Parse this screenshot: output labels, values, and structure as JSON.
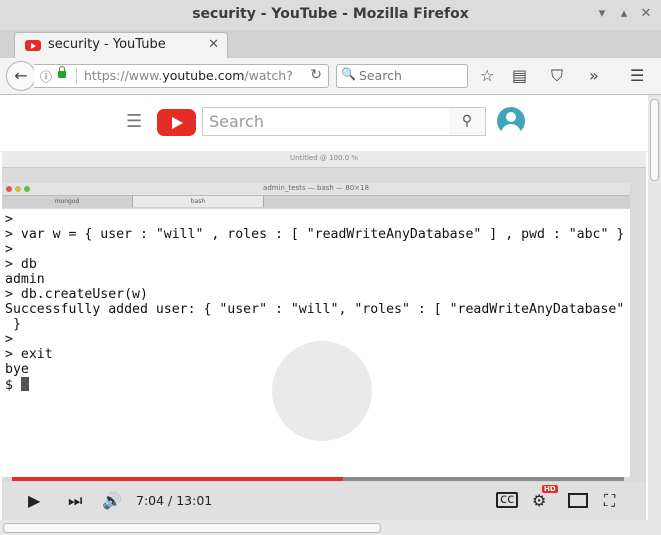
{
  "window": {
    "title": "security - YouTube - Mozilla Firefox"
  },
  "tab": {
    "title": "security - YouTube"
  },
  "navbar": {
    "url_prefix": "https://www.",
    "url_domain": "youtube.com",
    "url_suffix": "/watch?",
    "search_placeholder": "Search"
  },
  "youtube": {
    "search_placeholder": "Search"
  },
  "video": {
    "screen_title": "Untitled @ 100.0 %",
    "terminal_title": "admin_tests — bash — 80×18",
    "terminal_tabs": [
      "mongod",
      "bash"
    ],
    "terminal_lines": [
      ">",
      "> var w = { user : \"will\" , roles : [ \"readWriteAnyDatabase\" ] , pwd : \"abc\" }",
      ">",
      "> db",
      "admin",
      "> db.createUser(w)",
      "Successfully added user: { \"user\" : \"will\", \"roles\" : [ \"readWriteAnyDatabase\" ]",
      " }",
      ">",
      "> exit",
      "bye",
      "$ "
    ],
    "time_display": "7:04 / 13:01",
    "progress_fraction": 0.5416,
    "hd_badge": "HD",
    "accent_color": "#e52d27"
  }
}
